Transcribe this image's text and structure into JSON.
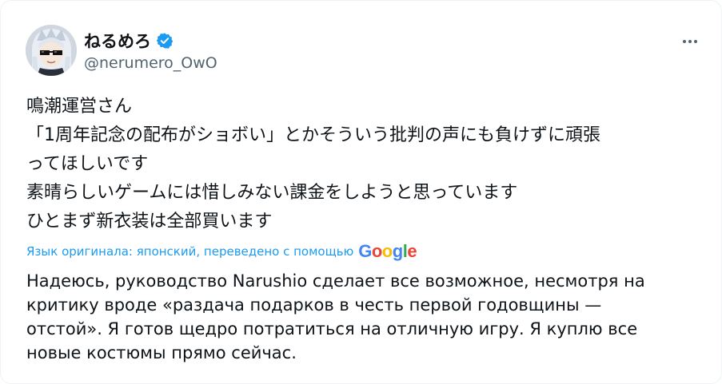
{
  "author": {
    "display_name": "ねるめろ",
    "handle": "@nerumero_OwO",
    "verified_icon": "verified-badge-icon",
    "avatar_icon": "anime-avatar-with-sunglasses"
  },
  "menu": {
    "icon": "more-horizontal-icon"
  },
  "tweet": {
    "lines": [
      "鳴潮運営さん",
      "「1周年記念の配布がショボい」とかそういう批判の声にも負けずに頑張",
      "ってほしいです",
      "素晴らしいゲームには惜しみない課金をしようと思っています",
      "ひとまず新衣装は全部買います"
    ]
  },
  "translation": {
    "note": "Язык оригинала: японский, переведено с помощью",
    "provider_letters": [
      "G",
      "o",
      "o",
      "g",
      "l",
      "e"
    ],
    "lines": [
      "Надеюсь, руководство Narushio сделает все возможное, несмотря на",
      "критику вроде «раздача подарков в честь первой годовщины —",
      "отстой». Я готов щедро потратиться на отличную игру. Я куплю все",
      "новые костюмы прямо сейчас."
    ]
  },
  "colors": {
    "text": "#0f1419",
    "secondary": "#536471",
    "link": "#1d9bf0",
    "google_blue": "#4285F4",
    "google_red": "#EA4335",
    "google_yellow": "#FBBC05",
    "google_green": "#34A853"
  }
}
